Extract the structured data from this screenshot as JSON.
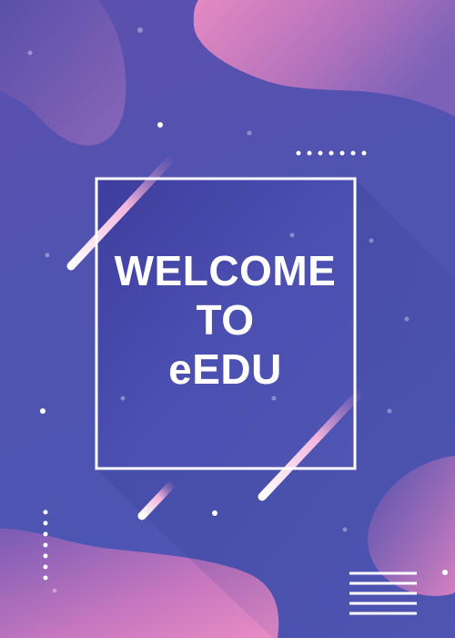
{
  "poster": {
    "headline_lines": [
      "WELCOME",
      "TO",
      "eEDU"
    ]
  },
  "colors": {
    "background_top": "#5d4fae",
    "background_bottom": "#4d55b2",
    "blob_pink": "#e08ac4",
    "blob_purple": "#7c5bb5",
    "frame": "#ffffff",
    "text": "#ffffff"
  }
}
